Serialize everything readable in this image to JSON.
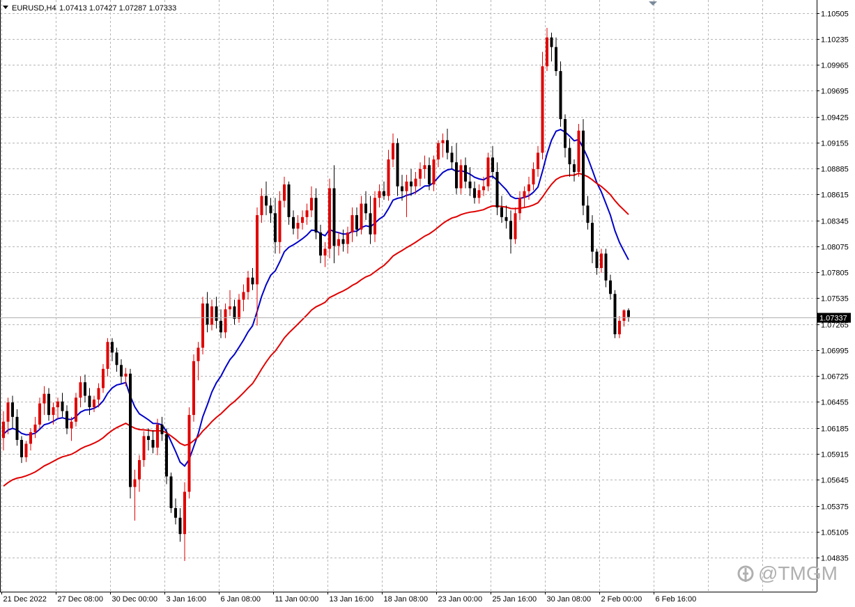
{
  "header": {
    "symbol": "EURUSD,H4",
    "ohlc": "1.07413 1.07427 1.07287 1.07333"
  },
  "watermark": {
    "text": "@TMGM",
    "icon": "tmgm-logo-icon"
  },
  "colors": {
    "bull": "#e00000",
    "bear": "#000000",
    "ma_fast": "#0000c8",
    "ma_slow": "#e00000",
    "grid": "#b5b5b5",
    "price_tag_bg": "#000000"
  },
  "chart_data": {
    "type": "candlestick",
    "title": "EURUSD,H4",
    "price_tag": "1.07337",
    "ylim": [
      1.0448,
      1.1064
    ],
    "y_ticks": [
      "1.10505",
      "1.10235",
      "1.09965",
      "1.09695",
      "1.09425",
      "1.09155",
      "1.08885",
      "1.08615",
      "1.08345",
      "1.08075",
      "1.07805",
      "1.07535",
      "1.07265",
      "1.06995",
      "1.06725",
      "1.06455",
      "1.06185",
      "1.05915",
      "1.05645",
      "1.05375",
      "1.05105",
      "1.04835"
    ],
    "x_ticks": [
      "21 Dec 2022",
      "27 Dec 08:00",
      "30 Dec 00:00",
      "3 Jan 16:00",
      "6 Jan 08:00",
      "11 Jan 00:00",
      "13 Jan 16:00",
      "18 Jan 08:00",
      "23 Jan 00:00",
      "25 Jan 16:00",
      "30 Jan 08:00",
      "2 Feb 00:00",
      "6 Feb 16:00"
    ],
    "grid": true,
    "candles": [
      {
        "o": 1.0608,
        "h": 1.0636,
        "l": 1.0595,
        "c": 1.0625
      },
      {
        "o": 1.0625,
        "h": 1.065,
        "l": 1.0612,
        "c": 1.0645
      },
      {
        "o": 1.0645,
        "h": 1.0652,
        "l": 1.0618,
        "c": 1.063
      },
      {
        "o": 1.063,
        "h": 1.0638,
        "l": 1.06,
        "c": 1.0606
      },
      {
        "o": 1.0606,
        "h": 1.061,
        "l": 1.0582,
        "c": 1.0588
      },
      {
        "o": 1.0588,
        "h": 1.0605,
        "l": 1.0583,
        "c": 1.0602
      },
      {
        "o": 1.0602,
        "h": 1.0618,
        "l": 1.0595,
        "c": 1.0614
      },
      {
        "o": 1.0614,
        "h": 1.063,
        "l": 1.0608,
        "c": 1.0622
      },
      {
        "o": 1.0622,
        "h": 1.065,
        "l": 1.0618,
        "c": 1.0644
      },
      {
        "o": 1.0644,
        "h": 1.0662,
        "l": 1.0632,
        "c": 1.0654
      },
      {
        "o": 1.0654,
        "h": 1.066,
        "l": 1.0626,
        "c": 1.0632
      },
      {
        "o": 1.0632,
        "h": 1.0645,
        "l": 1.0622,
        "c": 1.064
      },
      {
        "o": 1.064,
        "h": 1.065,
        "l": 1.0628,
        "c": 1.0646
      },
      {
        "o": 1.0646,
        "h": 1.0655,
        "l": 1.063,
        "c": 1.0636
      },
      {
        "o": 1.0636,
        "h": 1.0642,
        "l": 1.0612,
        "c": 1.0618
      },
      {
        "o": 1.0618,
        "h": 1.063,
        "l": 1.0605,
        "c": 1.0625
      },
      {
        "o": 1.0625,
        "h": 1.0655,
        "l": 1.062,
        "c": 1.065
      },
      {
        "o": 1.065,
        "h": 1.0672,
        "l": 1.064,
        "c": 1.0666
      },
      {
        "o": 1.0666,
        "h": 1.0674,
        "l": 1.0645,
        "c": 1.0652
      },
      {
        "o": 1.0652,
        "h": 1.066,
        "l": 1.0632,
        "c": 1.064
      },
      {
        "o": 1.064,
        "h": 1.0652,
        "l": 1.0635,
        "c": 1.0648
      },
      {
        "o": 1.0648,
        "h": 1.0665,
        "l": 1.064,
        "c": 1.066
      },
      {
        "o": 1.066,
        "h": 1.0685,
        "l": 1.0655,
        "c": 1.068
      },
      {
        "o": 1.068,
        "h": 1.0712,
        "l": 1.0672,
        "c": 1.0708
      },
      {
        "o": 1.0708,
        "h": 1.0712,
        "l": 1.0688,
        "c": 1.0697
      },
      {
        "o": 1.0697,
        "h": 1.0702,
        "l": 1.0677,
        "c": 1.0684
      },
      {
        "o": 1.0684,
        "h": 1.069,
        "l": 1.0665,
        "c": 1.0672
      },
      {
        "o": 1.0672,
        "h": 1.0681,
        "l": 1.0662,
        "c": 1.0675
      },
      {
        "o": 1.0675,
        "h": 1.068,
        "l": 1.0545,
        "c": 1.0557
      },
      {
        "o": 1.0557,
        "h": 1.0575,
        "l": 1.0522,
        "c": 1.0565
      },
      {
        "o": 1.0565,
        "h": 1.059,
        "l": 1.0552,
        "c": 1.0585
      },
      {
        "o": 1.0585,
        "h": 1.0615,
        "l": 1.0578,
        "c": 1.061
      },
      {
        "o": 1.061,
        "h": 1.0618,
        "l": 1.0595,
        "c": 1.0606
      },
      {
        "o": 1.0606,
        "h": 1.0616,
        "l": 1.0592,
        "c": 1.0598
      },
      {
        "o": 1.0598,
        "h": 1.0628,
        "l": 1.059,
        "c": 1.0622
      },
      {
        "o": 1.0622,
        "h": 1.063,
        "l": 1.0605,
        "c": 1.0612
      },
      {
        "o": 1.0612,
        "h": 1.0618,
        "l": 1.056,
        "c": 1.0568
      },
      {
        "o": 1.0568,
        "h": 1.0572,
        "l": 1.053,
        "c": 1.0535
      },
      {
        "o": 1.0535,
        "h": 1.0545,
        "l": 1.0518,
        "c": 1.0525
      },
      {
        "o": 1.0525,
        "h": 1.0535,
        "l": 1.05,
        "c": 1.0508
      },
      {
        "o": 1.0508,
        "h": 1.0562,
        "l": 1.048,
        "c": 1.0552
      },
      {
        "o": 1.0552,
        "h": 1.064,
        "l": 1.0545,
        "c": 1.0632
      },
      {
        "o": 1.0632,
        "h": 1.0695,
        "l": 1.0625,
        "c": 1.0688
      },
      {
        "o": 1.0688,
        "h": 1.0708,
        "l": 1.0668,
        "c": 1.0702
      },
      {
        "o": 1.0702,
        "h": 1.0755,
        "l": 1.0695,
        "c": 1.0748
      },
      {
        "o": 1.0748,
        "h": 1.076,
        "l": 1.0718,
        "c": 1.0726
      },
      {
        "o": 1.0726,
        "h": 1.0752,
        "l": 1.072,
        "c": 1.0745
      },
      {
        "o": 1.0745,
        "h": 1.0755,
        "l": 1.0722,
        "c": 1.073
      },
      {
        "o": 1.073,
        "h": 1.0742,
        "l": 1.0712,
        "c": 1.0718
      },
      {
        "o": 1.0718,
        "h": 1.0748,
        "l": 1.0712,
        "c": 1.0742
      },
      {
        "o": 1.0742,
        "h": 1.0762,
        "l": 1.0735,
        "c": 1.0745
      },
      {
        "o": 1.0745,
        "h": 1.0752,
        "l": 1.0726,
        "c": 1.0732
      },
      {
        "o": 1.0732,
        "h": 1.0758,
        "l": 1.0728,
        "c": 1.0752
      },
      {
        "o": 1.0752,
        "h": 1.0768,
        "l": 1.074,
        "c": 1.076
      },
      {
        "o": 1.076,
        "h": 1.0782,
        "l": 1.0752,
        "c": 1.0775
      },
      {
        "o": 1.0775,
        "h": 1.0785,
        "l": 1.0762,
        "c": 1.0768
      },
      {
        "o": 1.0768,
        "h": 1.0848,
        "l": 1.0725,
        "c": 1.084
      },
      {
        "o": 1.084,
        "h": 1.0868,
        "l": 1.0832,
        "c": 1.086
      },
      {
        "o": 1.086,
        "h": 1.0875,
        "l": 1.084,
        "c": 1.085
      },
      {
        "o": 1.085,
        "h": 1.0858,
        "l": 1.0832,
        "c": 1.0842
      },
      {
        "o": 1.0842,
        "h": 1.0858,
        "l": 1.08,
        "c": 1.0812
      },
      {
        "o": 1.0812,
        "h": 1.0865,
        "l": 1.08,
        "c": 1.0855
      },
      {
        "o": 1.0855,
        "h": 1.088,
        "l": 1.0848,
        "c": 1.0872
      },
      {
        "o": 1.0872,
        "h": 1.0875,
        "l": 1.083,
        "c": 1.0838
      },
      {
        "o": 1.0838,
        "h": 1.0845,
        "l": 1.082,
        "c": 1.0826
      },
      {
        "o": 1.0826,
        "h": 1.084,
        "l": 1.0815,
        "c": 1.0832
      },
      {
        "o": 1.0832,
        "h": 1.0845,
        "l": 1.0825,
        "c": 1.0838
      },
      {
        "o": 1.0838,
        "h": 1.0852,
        "l": 1.083,
        "c": 1.0845
      },
      {
        "o": 1.0845,
        "h": 1.087,
        "l": 1.0838,
        "c": 1.0858
      },
      {
        "o": 1.0858,
        "h": 1.0868,
        "l": 1.0815,
        "c": 1.0822
      },
      {
        "o": 1.0822,
        "h": 1.083,
        "l": 1.079,
        "c": 1.0798
      },
      {
        "o": 1.0798,
        "h": 1.0812,
        "l": 1.0786,
        "c": 1.0805
      },
      {
        "o": 1.0805,
        "h": 1.0878,
        "l": 1.0795,
        "c": 1.0868
      },
      {
        "o": 1.0868,
        "h": 1.0892,
        "l": 1.079,
        "c": 1.0808
      },
      {
        "o": 1.0808,
        "h": 1.0822,
        "l": 1.0798,
        "c": 1.0815
      },
      {
        "o": 1.0815,
        "h": 1.0825,
        "l": 1.0802,
        "c": 1.081
      },
      {
        "o": 1.081,
        "h": 1.0828,
        "l": 1.08,
        "c": 1.0822
      },
      {
        "o": 1.0822,
        "h": 1.0848,
        "l": 1.0812,
        "c": 1.084
      },
      {
        "o": 1.084,
        "h": 1.0848,
        "l": 1.0818,
        "c": 1.0825
      },
      {
        "o": 1.0825,
        "h": 1.086,
        "l": 1.082,
        "c": 1.0852
      },
      {
        "o": 1.0852,
        "h": 1.0865,
        "l": 1.0835,
        "c": 1.0842
      },
      {
        "o": 1.0842,
        "h": 1.086,
        "l": 1.081,
        "c": 1.082
      },
      {
        "o": 1.082,
        "h": 1.0865,
        "l": 1.0812,
        "c": 1.0858
      },
      {
        "o": 1.0858,
        "h": 1.0872,
        "l": 1.0848,
        "c": 1.0865
      },
      {
        "o": 1.0865,
        "h": 1.0875,
        "l": 1.0856,
        "c": 1.086
      },
      {
        "o": 1.086,
        "h": 1.0908,
        "l": 1.0855,
        "c": 1.0898
      },
      {
        "o": 1.0898,
        "h": 1.0925,
        "l": 1.089,
        "c": 1.0915
      },
      {
        "o": 1.0915,
        "h": 1.092,
        "l": 1.086,
        "c": 1.087
      },
      {
        "o": 1.087,
        "h": 1.0882,
        "l": 1.0855,
        "c": 1.0865
      },
      {
        "o": 1.0865,
        "h": 1.0882,
        "l": 1.0838,
        "c": 1.0875
      },
      {
        "o": 1.0875,
        "h": 1.0888,
        "l": 1.086,
        "c": 1.087
      },
      {
        "o": 1.087,
        "h": 1.0885,
        "l": 1.0862,
        "c": 1.0878
      },
      {
        "o": 1.0878,
        "h": 1.0895,
        "l": 1.087,
        "c": 1.0888
      },
      {
        "o": 1.0888,
        "h": 1.0902,
        "l": 1.0878,
        "c": 1.0892
      },
      {
        "o": 1.0892,
        "h": 1.09,
        "l": 1.0866,
        "c": 1.0872
      },
      {
        "o": 1.0872,
        "h": 1.0902,
        "l": 1.0865,
        "c": 1.0898
      },
      {
        "o": 1.0898,
        "h": 1.0918,
        "l": 1.089,
        "c": 1.0915
      },
      {
        "o": 1.0915,
        "h": 1.0925,
        "l": 1.09,
        "c": 1.0918
      },
      {
        "o": 1.0918,
        "h": 1.093,
        "l": 1.0898,
        "c": 1.0905
      },
      {
        "o": 1.0905,
        "h": 1.0912,
        "l": 1.0888,
        "c": 1.0895
      },
      {
        "o": 1.0895,
        "h": 1.0915,
        "l": 1.0862,
        "c": 1.0868
      },
      {
        "o": 1.0868,
        "h": 1.0898,
        "l": 1.0862,
        "c": 1.0892
      },
      {
        "o": 1.0892,
        "h": 1.09,
        "l": 1.0868,
        "c": 1.0875
      },
      {
        "o": 1.0875,
        "h": 1.089,
        "l": 1.086,
        "c": 1.0868
      },
      {
        "o": 1.0868,
        "h": 1.0875,
        "l": 1.0852,
        "c": 1.0858
      },
      {
        "o": 1.0858,
        "h": 1.0872,
        "l": 1.0852,
        "c": 1.0866
      },
      {
        "o": 1.0866,
        "h": 1.088,
        "l": 1.086,
        "c": 1.087
      },
      {
        "o": 1.087,
        "h": 1.0905,
        "l": 1.0865,
        "c": 1.09
      },
      {
        "o": 1.09,
        "h": 1.0912,
        "l": 1.0878,
        "c": 1.0885
      },
      {
        "o": 1.0885,
        "h": 1.0895,
        "l": 1.084,
        "c": 1.0848
      },
      {
        "o": 1.0848,
        "h": 1.086,
        "l": 1.0832,
        "c": 1.0838
      },
      {
        "o": 1.0838,
        "h": 1.085,
        "l": 1.0826,
        "c": 1.0834
      },
      {
        "o": 1.0834,
        "h": 1.0845,
        "l": 1.08,
        "c": 1.0815
      },
      {
        "o": 1.0815,
        "h": 1.0848,
        "l": 1.081,
        "c": 1.0842
      },
      {
        "o": 1.0842,
        "h": 1.0865,
        "l": 1.0835,
        "c": 1.0858
      },
      {
        "o": 1.0858,
        "h": 1.087,
        "l": 1.0848,
        "c": 1.0865
      },
      {
        "o": 1.0865,
        "h": 1.088,
        "l": 1.0856,
        "c": 1.0872
      },
      {
        "o": 1.0872,
        "h": 1.0895,
        "l": 1.0866,
        "c": 1.0888
      },
      {
        "o": 1.0888,
        "h": 1.0912,
        "l": 1.088,
        "c": 1.0905
      },
      {
        "o": 1.0905,
        "h": 1.101,
        "l": 1.0898,
        "c": 1.0995
      },
      {
        "o": 1.0995,
        "h": 1.1035,
        "l": 1.099,
        "c": 1.1025
      },
      {
        "o": 1.1025,
        "h": 1.103,
        "l": 1.1,
        "c": 1.1015
      },
      {
        "o": 1.1015,
        "h": 1.1025,
        "l": 1.0985,
        "c": 1.099
      },
      {
        "o": 1.099,
        "h": 1.1,
        "l": 1.0932,
        "c": 1.094
      },
      {
        "o": 1.094,
        "h": 1.0945,
        "l": 1.09,
        "c": 1.091
      },
      {
        "o": 1.091,
        "h": 1.092,
        "l": 1.088,
        "c": 1.0893
      },
      {
        "o": 1.0893,
        "h": 1.0898,
        "l": 1.0875,
        "c": 1.0885
      },
      {
        "o": 1.0885,
        "h": 1.0935,
        "l": 1.088,
        "c": 1.0928
      },
      {
        "o": 1.0928,
        "h": 1.094,
        "l": 1.084,
        "c": 1.085
      },
      {
        "o": 1.085,
        "h": 1.086,
        "l": 1.0825,
        "c": 1.0832
      },
      {
        "o": 1.0832,
        "h": 1.084,
        "l": 1.079,
        "c": 1.0802
      },
      {
        "o": 1.0802,
        "h": 1.0805,
        "l": 1.0778,
        "c": 1.0785
      },
      {
        "o": 1.0785,
        "h": 1.0805,
        "l": 1.078,
        "c": 1.08
      },
      {
        "o": 1.08,
        "h": 1.0805,
        "l": 1.0765,
        "c": 1.0772
      },
      {
        "o": 1.0772,
        "h": 1.0778,
        "l": 1.0752,
        "c": 1.0758
      },
      {
        "o": 1.0758,
        "h": 1.0762,
        "l": 1.0712,
        "c": 1.0716
      },
      {
        "o": 1.0716,
        "h": 1.0735,
        "l": 1.0712,
        "c": 1.073
      },
      {
        "o": 1.073,
        "h": 1.0742,
        "l": 1.0724,
        "c": 1.0741
      },
      {
        "o": 1.0741,
        "h": 1.0743,
        "l": 1.0729,
        "c": 1.0734
      }
    ],
    "series": [
      {
        "name": "",
        "color": "#0000c8",
        "smoothing": 0.13
      },
      {
        "name": "",
        "color": "#e00000",
        "smoothing": 0.042
      }
    ]
  }
}
